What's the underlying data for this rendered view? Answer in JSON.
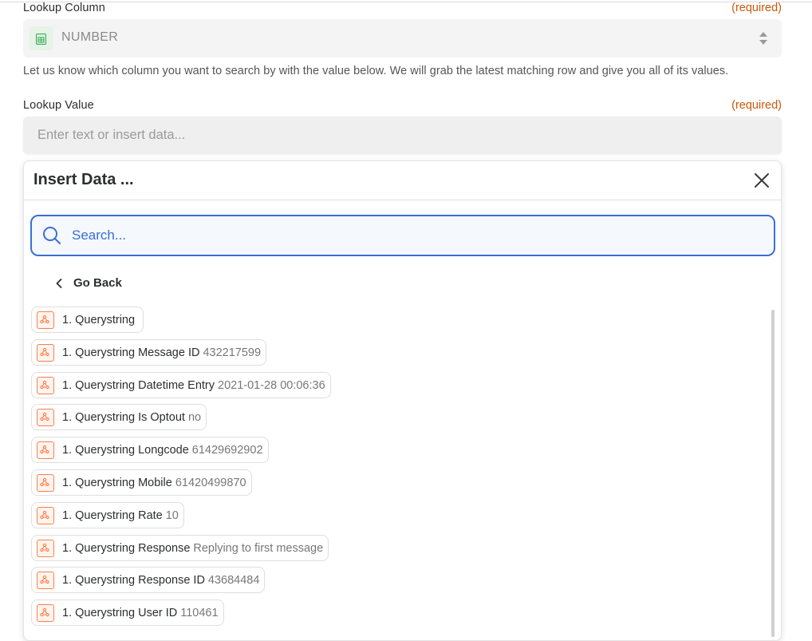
{
  "lookup_column": {
    "label": "Lookup Column",
    "required": "(required)",
    "value": "NUMBER",
    "help": "Let us know which column you want to search by with the value below. We will grab the latest matching row and give you all of its values."
  },
  "lookup_value": {
    "label": "Lookup Value",
    "required": "(required)",
    "placeholder": "Enter text or insert data..."
  },
  "insert_panel": {
    "title": "Insert Data ...",
    "search_placeholder": "Search...",
    "go_back": "Go Back",
    "items": [
      {
        "label": "1. Querystring",
        "value": ""
      },
      {
        "label": "1. Querystring Message ID",
        "value": "432217599"
      },
      {
        "label": "1. Querystring Datetime Entry",
        "value": "2021-01-28 00:06:36"
      },
      {
        "label": "1. Querystring Is Optout",
        "value": "no"
      },
      {
        "label": "1. Querystring Longcode",
        "value": "61429692902"
      },
      {
        "label": "1. Querystring Mobile",
        "value": "61420499870"
      },
      {
        "label": "1. Querystring Rate",
        "value": "10"
      },
      {
        "label": "1. Querystring Response",
        "value": "Replying to first message"
      },
      {
        "label": "1. Querystring Response ID",
        "value": "43684484"
      },
      {
        "label": "1. Querystring User ID",
        "value": "110461"
      }
    ]
  },
  "colors": {
    "required": "#c9590a",
    "accent": "#3b6fd1",
    "webhook_icon": "#ff7e47",
    "sheets_icon": "#34a853"
  },
  "icons": {
    "sheets": "spreadsheet-icon",
    "webhook": "webhook-icon",
    "search": "search-icon",
    "close": "close-icon",
    "back": "chevron-left-icon"
  }
}
